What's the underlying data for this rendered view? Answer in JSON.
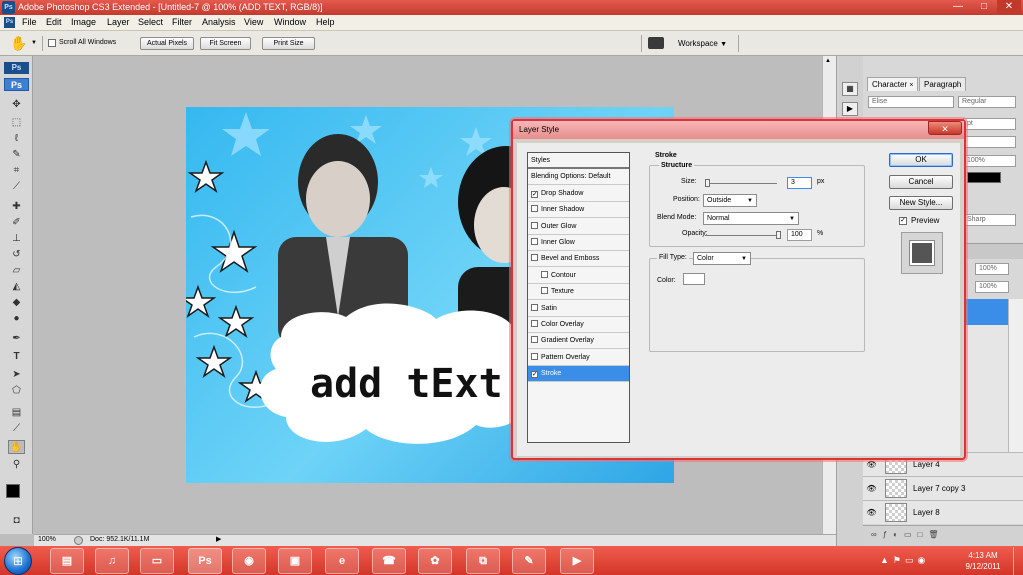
{
  "window": {
    "title": "Adobe Photoshop CS3 Extended - [Untitled-7 @ 100% (ADD TEXT, RGB/8)]",
    "app_badge": "Ps",
    "minimize": "—",
    "maximize": "□",
    "close": "✕"
  },
  "menu": [
    "File",
    "Edit",
    "Image",
    "Layer",
    "Select",
    "Filter",
    "Analysis",
    "View",
    "Window",
    "Help"
  ],
  "options_bar": {
    "scroll_all_windows": "Scroll All Windows",
    "actual_pixels": "Actual Pixels",
    "fit_screen": "Fit Screen",
    "print_size": "Print Size",
    "workspace": "Workspace"
  },
  "tools_badge": "Ps",
  "canvas": {
    "text": "add tExt"
  },
  "status_bar": {
    "zoom": "100%",
    "doc": "Doc: 952.1K/11.1M"
  },
  "panels": {
    "tabs": [
      "Character",
      "Paragraph"
    ],
    "font_family": "Elise",
    "font_style": "Regular",
    "size_unit": "pt",
    "opacity": "100%",
    "fill": "100%",
    "antialias": "Sharp",
    "tracking": "100%",
    "layers": [
      {
        "name": "Layer 4"
      },
      {
        "name": "Layer 7 copy 3"
      },
      {
        "name": "Layer 8"
      }
    ]
  },
  "dialog": {
    "title": "Layer Style",
    "close": "✕",
    "styles": [
      {
        "label": "Styles",
        "checkbox": false,
        "checked": false
      },
      {
        "label": "Blending Options: Default",
        "checkbox": false,
        "checked": false
      },
      {
        "label": "Drop Shadow",
        "checkbox": true,
        "checked": true
      },
      {
        "label": "Inner Shadow",
        "checkbox": true,
        "checked": false
      },
      {
        "label": "Outer Glow",
        "checkbox": true,
        "checked": false
      },
      {
        "label": "Inner Glow",
        "checkbox": true,
        "checked": false
      },
      {
        "label": "Bevel and Emboss",
        "checkbox": true,
        "checked": false
      },
      {
        "label": "Contour",
        "checkbox": true,
        "checked": false,
        "indent": true
      },
      {
        "label": "Texture",
        "checkbox": true,
        "checked": false,
        "indent": true
      },
      {
        "label": "Satin",
        "checkbox": true,
        "checked": false
      },
      {
        "label": "Color Overlay",
        "checkbox": true,
        "checked": false
      },
      {
        "label": "Gradient Overlay",
        "checkbox": true,
        "checked": false
      },
      {
        "label": "Pattern Overlay",
        "checkbox": true,
        "checked": false
      },
      {
        "label": "Stroke",
        "checkbox": true,
        "checked": true,
        "selected": true
      }
    ],
    "stroke": {
      "heading": "Stroke",
      "structure": "Structure",
      "size_label": "Size:",
      "size_value": "3",
      "size_unit": "px",
      "position_label": "Position:",
      "position_value": "Outside",
      "blend_mode_label": "Blend Mode:",
      "blend_mode_value": "Normal",
      "opacity_label": "Opacity:",
      "opacity_value": "100",
      "opacity_unit": "%",
      "fill_type_label": "Fill Type:",
      "fill_type_value": "Color",
      "color_label": "Color:",
      "color_value": "#ffffff"
    },
    "buttons": {
      "ok": "OK",
      "cancel": "Cancel",
      "new_style": "New Style...",
      "preview": "Preview"
    },
    "preview_checked": true
  },
  "taskbar": {
    "items": [
      "windows-explorer",
      "media-player",
      "file-folder",
      "photoshop",
      "chrome",
      "paint",
      "internet-explorer",
      "google-talk",
      "media-center",
      "window-manager",
      "palette",
      "media-classic"
    ],
    "time": "4:13 AM",
    "date": "9/12/2011"
  },
  "colors": {
    "accent": "#3b8ee8",
    "dialog_border": "#d9343a",
    "taskbar": "#e04a3c"
  }
}
